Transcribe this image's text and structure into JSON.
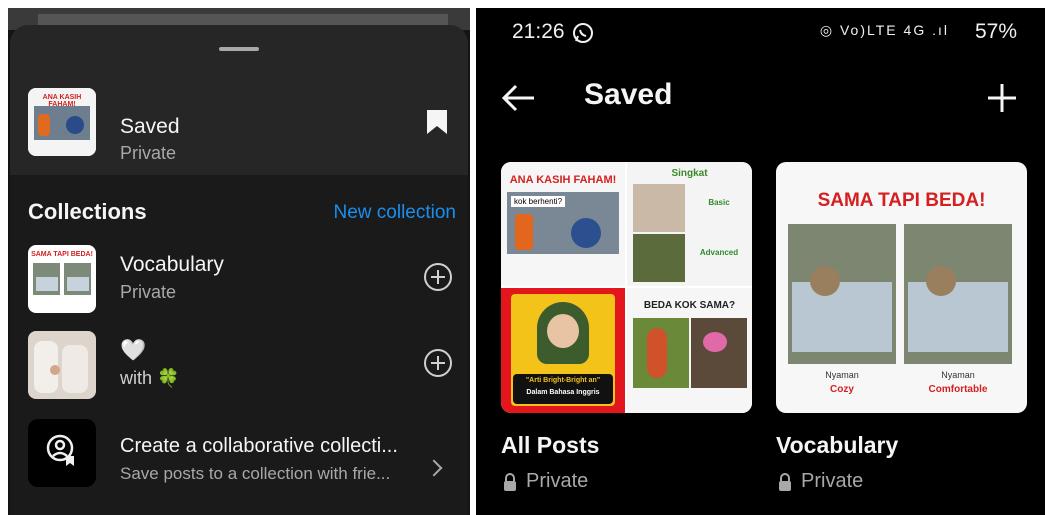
{
  "sheet": {
    "saved_title": "Saved",
    "saved_sub": "Private",
    "thumb_caption": "ANA KASIH FAHAM!",
    "collections_heading": "Collections",
    "new_collection": "New collection",
    "items": [
      {
        "title": "Vocabulary",
        "sub": "Private",
        "thumb_caption": "SAMA TAPI BEDA!"
      },
      {
        "title": "🤍",
        "sub": "with 🍀"
      }
    ],
    "collab_title": "Create a collaborative collecti...",
    "collab_sub": "Save posts to a collection with frie..."
  },
  "status": {
    "time": "21:26",
    "icons": "◎ Vo)LTE 4G .ıl",
    "battery": "57%"
  },
  "header": {
    "title": "Saved"
  },
  "collections": [
    {
      "title": "All Posts",
      "sub": "Private",
      "tiles": {
        "t1": "ANA KASIH FAHAM!",
        "t1_bubble": "kok berhenti?",
        "t2": "Singkat",
        "t2_a": "Basic",
        "t2_b": "Advanced",
        "t3_a": "\"Arti Bright-Bright an\"",
        "t3_b": "Dalam Bahasa Inggris",
        "t4": "BEDA KOK SAMA?"
      }
    },
    {
      "title": "Vocabulary",
      "sub": "Private",
      "heading": "SAMA TAPI BEDA!",
      "left_word": "Nyaman",
      "left_en": "Cozy",
      "right_word": "Nyaman",
      "right_en": "Comfortable"
    }
  ]
}
